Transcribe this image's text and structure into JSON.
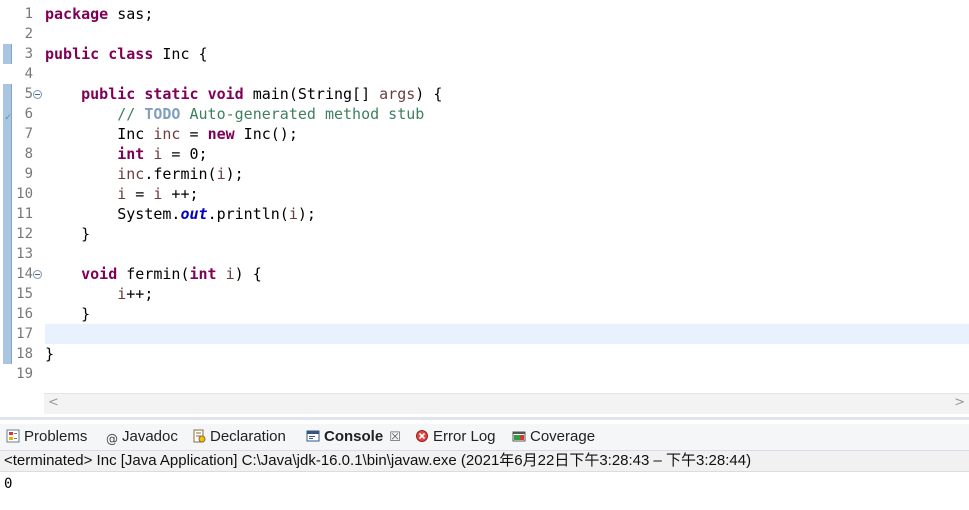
{
  "editor": {
    "lines": [
      {
        "n": "1",
        "tokens": [
          {
            "t": "package",
            "c": "kw"
          },
          {
            "t": " sas;"
          }
        ]
      },
      {
        "n": "2",
        "tokens": []
      },
      {
        "n": "3",
        "tokens": [
          {
            "t": "public",
            "c": "kw"
          },
          {
            "t": " "
          },
          {
            "t": "class",
            "c": "kw"
          },
          {
            "t": " Inc {"
          }
        ]
      },
      {
        "n": "4",
        "tokens": []
      },
      {
        "n": "5",
        "fold": true,
        "tokens": [
          {
            "t": "    "
          },
          {
            "t": "public",
            "c": "kw"
          },
          {
            "t": " "
          },
          {
            "t": "static",
            "c": "kw"
          },
          {
            "t": " "
          },
          {
            "t": "void",
            "c": "kw"
          },
          {
            "t": " main(String[] "
          },
          {
            "t": "args",
            "c": "param"
          },
          {
            "t": ") {"
          }
        ]
      },
      {
        "n": "6",
        "todo": true,
        "tokens": [
          {
            "t": "        "
          },
          {
            "t": "// ",
            "c": "cm"
          },
          {
            "t": "TODO",
            "c": "todo"
          },
          {
            "t": " Auto-generated method stub",
            "c": "cm"
          }
        ]
      },
      {
        "n": "7",
        "tokens": [
          {
            "t": "        Inc "
          },
          {
            "t": "inc",
            "c": "param"
          },
          {
            "t": " = "
          },
          {
            "t": "new",
            "c": "kw"
          },
          {
            "t": " Inc();"
          }
        ]
      },
      {
        "n": "8",
        "tokens": [
          {
            "t": "        "
          },
          {
            "t": "int",
            "c": "kw"
          },
          {
            "t": " "
          },
          {
            "t": "i",
            "c": "param"
          },
          {
            "t": " = 0;"
          }
        ]
      },
      {
        "n": "9",
        "tokens": [
          {
            "t": "        "
          },
          {
            "t": "inc",
            "c": "param"
          },
          {
            "t": ".fermin("
          },
          {
            "t": "i",
            "c": "param"
          },
          {
            "t": ");"
          }
        ]
      },
      {
        "n": "10",
        "tokens": [
          {
            "t": "        "
          },
          {
            "t": "i",
            "c": "param"
          },
          {
            "t": " = "
          },
          {
            "t": "i",
            "c": "param"
          },
          {
            "t": " ++;"
          }
        ]
      },
      {
        "n": "11",
        "tokens": [
          {
            "t": "        System."
          },
          {
            "t": "out",
            "c": "st"
          },
          {
            "t": ".println("
          },
          {
            "t": "i",
            "c": "param"
          },
          {
            "t": ");"
          }
        ]
      },
      {
        "n": "12",
        "tokens": [
          {
            "t": "    }"
          }
        ]
      },
      {
        "n": "13",
        "tokens": []
      },
      {
        "n": "14",
        "fold": true,
        "tokens": [
          {
            "t": "    "
          },
          {
            "t": "void",
            "c": "kw"
          },
          {
            "t": " fermin("
          },
          {
            "t": "int",
            "c": "kw"
          },
          {
            "t": " "
          },
          {
            "t": "i",
            "c": "param"
          },
          {
            "t": ") {"
          }
        ]
      },
      {
        "n": "15",
        "tokens": [
          {
            "t": "        "
          },
          {
            "t": "i",
            "c": "param"
          },
          {
            "t": "++;"
          }
        ]
      },
      {
        "n": "16",
        "tokens": [
          {
            "t": "    }"
          }
        ]
      },
      {
        "n": "17",
        "current": true,
        "tokens": []
      },
      {
        "n": "18",
        "tokens": [
          {
            "t": "}"
          }
        ]
      },
      {
        "n": "19",
        "tokens": []
      }
    ],
    "scroll_left_glyph": "<",
    "scroll_right_glyph": ">"
  },
  "tabs": [
    {
      "label": "Problems",
      "icon": "problems-icon"
    },
    {
      "label": "Javadoc",
      "icon": "javadoc-icon"
    },
    {
      "label": "Declaration",
      "icon": "declaration-icon"
    },
    {
      "label": "Console",
      "icon": "console-icon",
      "active": true,
      "close": "☒"
    },
    {
      "label": "Error Log",
      "icon": "error-log-icon"
    },
    {
      "label": "Coverage",
      "icon": "coverage-icon"
    }
  ],
  "console": {
    "status": "<terminated> Inc [Java Application] C:\\Java\\jdk-16.0.1\\bin\\javaw.exe  (2021年6月22日下午3:28:43 – 下午3:28:44)",
    "output": "0"
  }
}
